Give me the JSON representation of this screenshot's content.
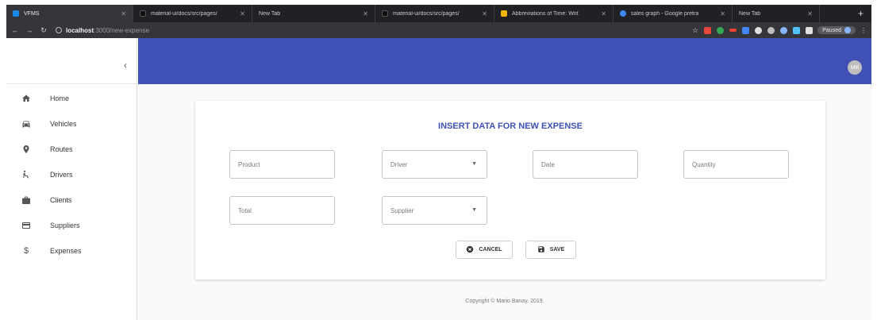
{
  "browser": {
    "tabs": [
      {
        "label": "VFMS",
        "active": true,
        "favicon_color": "#1e88e5"
      },
      {
        "label": "material-ui/docs/src/pages/",
        "active": false,
        "favicon_color": "#202124"
      },
      {
        "label": "New Tab",
        "active": false,
        "favicon_color": "#202124"
      },
      {
        "label": "material-ui/docs/src/pages/",
        "active": false,
        "favicon_color": "#202124"
      },
      {
        "label": "Abbreviations of Time: Writ",
        "active": false,
        "favicon_color": "#f4b400"
      },
      {
        "label": "sales graph - Google pretra",
        "active": false,
        "favicon_color": "#4285f4"
      },
      {
        "label": "New Tab",
        "active": false,
        "favicon_color": "#202124"
      }
    ],
    "url_host": "localhost",
    "url_path": ":3000/new-expense",
    "paused_label": "Paused"
  },
  "drawer": {
    "items": [
      {
        "label": "Home",
        "icon": "home-icon"
      },
      {
        "label": "Vehicles",
        "icon": "car-icon"
      },
      {
        "label": "Routes",
        "icon": "location-pin-icon"
      },
      {
        "label": "Drivers",
        "icon": "driver-icon"
      },
      {
        "label": "Clients",
        "icon": "briefcase-icon"
      },
      {
        "label": "Suppliers",
        "icon": "credit-card-icon"
      },
      {
        "label": "Expenses",
        "icon": "dollar-icon"
      }
    ]
  },
  "appbar": {
    "avatar_initials": "MB",
    "color": "#3f51b5"
  },
  "form": {
    "title": "INSERT DATA FOR NEW EXPENSE",
    "product_placeholder": "Product",
    "driver_placeholder": "Driver",
    "date_placeholder": "Date",
    "quantity_placeholder": "Quantity",
    "total_placeholder": "Total",
    "supplier_placeholder": "Supplier",
    "cancel_label": "CANCEL",
    "save_label": "SAVE"
  },
  "footer": {
    "copyright": "Copyright © Mario Banay, 2019."
  }
}
